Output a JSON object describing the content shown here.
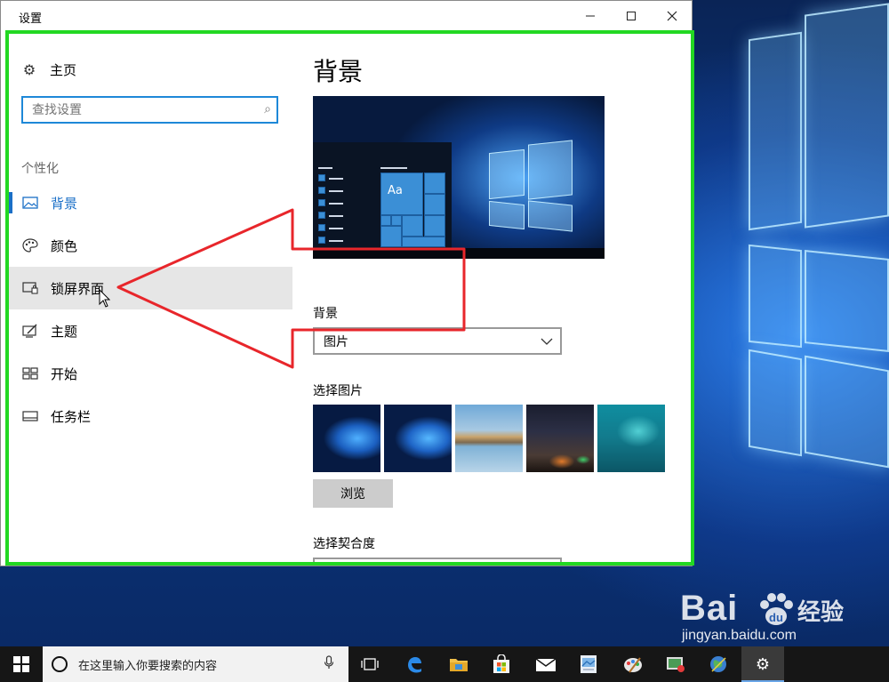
{
  "window": {
    "title": "设置",
    "minimize_icon": "minimize-icon",
    "maximize_icon": "maximize-icon",
    "close_icon": "close-icon"
  },
  "sidebar": {
    "home_label": "主页",
    "home_icon": "gear-icon",
    "search_placeholder": "查找设置",
    "search_icon": "search-icon",
    "section_label": "个性化",
    "items": [
      {
        "label": "背景",
        "icon": "image-icon",
        "state": "selected"
      },
      {
        "label": "颜色",
        "icon": "palette-icon",
        "state": "normal"
      },
      {
        "label": "锁屏界面",
        "icon": "lock-screen-icon",
        "state": "hover"
      },
      {
        "label": "主题",
        "icon": "theme-icon",
        "state": "normal"
      },
      {
        "label": "开始",
        "icon": "start-icon",
        "state": "normal"
      },
      {
        "label": "任务栏",
        "icon": "taskbar-icon",
        "state": "normal"
      }
    ]
  },
  "main": {
    "title": "背景",
    "preview_tile_label": "Aa",
    "background_label": "背景",
    "background_value": "图片",
    "choose_picture_label": "选择图片",
    "browse_label": "浏览",
    "choose_fit_label": "选择契合度"
  },
  "taskbar": {
    "search_text": "在这里输入你要搜索的内容",
    "apps": [
      "task-view-icon",
      "edge-icon",
      "file-explorer-icon",
      "store-icon",
      "mail-icon",
      "photos-icon",
      "paint-icon",
      "media-icon",
      "maps-icon",
      "settings-icon"
    ]
  },
  "watermark": {
    "logo": "Bai",
    "logo_text": "经验",
    "url": "jingyan.baidu.com"
  },
  "colors": {
    "accent": "#1a6fc7",
    "highlight_frame": "#22d822",
    "annotation_arrow": "#e8262b",
    "hover_bg": "#e6e6e6",
    "taskbar": "#161616"
  }
}
